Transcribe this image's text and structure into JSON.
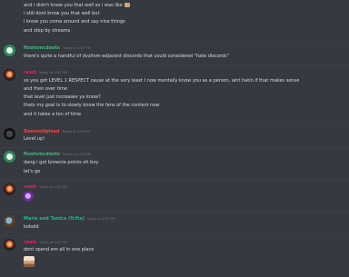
{
  "colors": {
    "background": "#36393f",
    "text": "#dcddde",
    "timestamp": "#72767d",
    "user_green": "#43b581",
    "user_pink": "#e91e63",
    "user_red": "#f04747",
    "user_teal": "#1abc9c"
  },
  "messages": [
    {
      "continuation": true,
      "lines": [
        "and i didn't know you that well so i was like",
        "i still dont know you that well but",
        "i know you come around and say nice things",
        "and stop by streams"
      ],
      "inline_emoji": "emoji"
    },
    {
      "username": "flootsmcdoots",
      "timestamp": "Today at 4:02 PM",
      "lines": [
        "there's quite a handful of dvz/lom-adjacent discords that could considered \"hate discords\""
      ]
    },
    {
      "username": "rawb",
      "timestamp": "Today at 4:02 PM",
      "lines": [
        "so you got LEVEL 1 RESPECT cause at the very least I now mentally know you as a person, aint hatin if that makes sense",
        "and then over time",
        "that level just increases ya know?",
        "thats my goal is to slowly know the fans of the content now",
        "and it takes a ton of time"
      ]
    },
    {
      "username": "DemonUpload",
      "timestamp": "Today at 4:03 PM",
      "lines": [
        "Level up!"
      ]
    },
    {
      "username": "flootsmcdoots",
      "timestamp": "Today at 4:03 PM",
      "lines": [
        "dang i got brownie points oh boy",
        "let's go"
      ]
    },
    {
      "username": "rawb",
      "timestamp": "Today at 4:03 PM",
      "lines": []
    },
    {
      "username": "Maris and Tanice (It/Its)",
      "timestamp": "Today at 4:03 PM",
      "lines": [
        "kobold"
      ]
    },
    {
      "username": "rawb",
      "timestamp": "Today at 4:03 PM",
      "lines": [
        "dont spend em all in one place"
      ]
    }
  ]
}
